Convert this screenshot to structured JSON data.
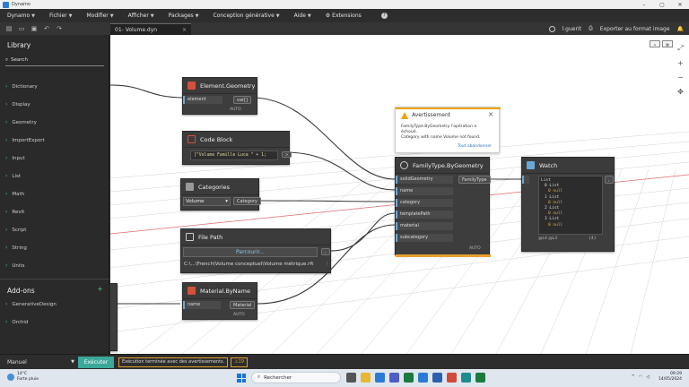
{
  "window": {
    "title": "Dynamo"
  },
  "menu": [
    "Dynamo",
    "Fichier",
    "Modifier",
    "Afficher",
    "Packages",
    "Conception générative",
    "Aide",
    "Extensions"
  ],
  "toolbar": {
    "tab_label": "01- Volume.dyn",
    "tab_close": "×",
    "user": "l.guerit",
    "export_label": "Exporter au format image"
  },
  "library": {
    "title": "Library",
    "search_placeholder": "Search",
    "items": [
      "Dictionary",
      "Display",
      "Geometry",
      "ImportExport",
      "Input",
      "List",
      "Math",
      "Revit",
      "Script",
      "String",
      "Units"
    ],
    "addons_title": "Add-ons",
    "addons": [
      "GenerativeDesign",
      "Orchid"
    ]
  },
  "nodes": {
    "element_geometry": {
      "title": "Element.Geometry",
      "input": "element",
      "output": "var[]",
      "lacing": "AUTO"
    },
    "code_block": {
      "title": "Code Block",
      "code": "[\"Volume Famille Luca \" + 1;",
      "output": ">"
    },
    "categories": {
      "title": "Categories",
      "value": "Volume",
      "output": "Category"
    },
    "file_path": {
      "title": "File Path",
      "button": "Parcourir...",
      "path": "C:\\...\\French\\Volume conceptuel\\Volume métrique.rft"
    },
    "material": {
      "title": "Material.ByName",
      "input": "name",
      "output": "Material",
      "lacing": "AUTO"
    },
    "family_type": {
      "title": "FamilyType.ByGeometry",
      "inputs": [
        "solidGeometry",
        "name",
        "category",
        "templatePath",
        "material",
        "subcategory"
      ],
      "output": "FamilyType",
      "lacing": "AUTO"
    },
    "watch": {
      "title": "Watch",
      "lines": [
        "List",
        "0 List",
        "0 null",
        "1 List",
        "0 null",
        "2 List",
        "0 null",
        "3 List",
        "0 null"
      ],
      "footer_left": "@L4 @L3",
      "footer_right": "{4}"
    }
  },
  "warning": {
    "title": "Avertissement",
    "line1": "FamilyType.ByGeometry l'opération a",
    "line2": "échoué.",
    "line3": "Category with name Volume not found.",
    "link": "Tout abandonner"
  },
  "statusbar": {
    "mode": "Manuel",
    "run": "Exécuter",
    "message": "Exécution terminée avec des avertissements.",
    "warning_count": "19"
  },
  "taskbar": {
    "temp": "14°C",
    "weather": "Forte pluie",
    "search_placeholder": "Rechercher",
    "time": "09:29",
    "date": "14/05/2024"
  }
}
